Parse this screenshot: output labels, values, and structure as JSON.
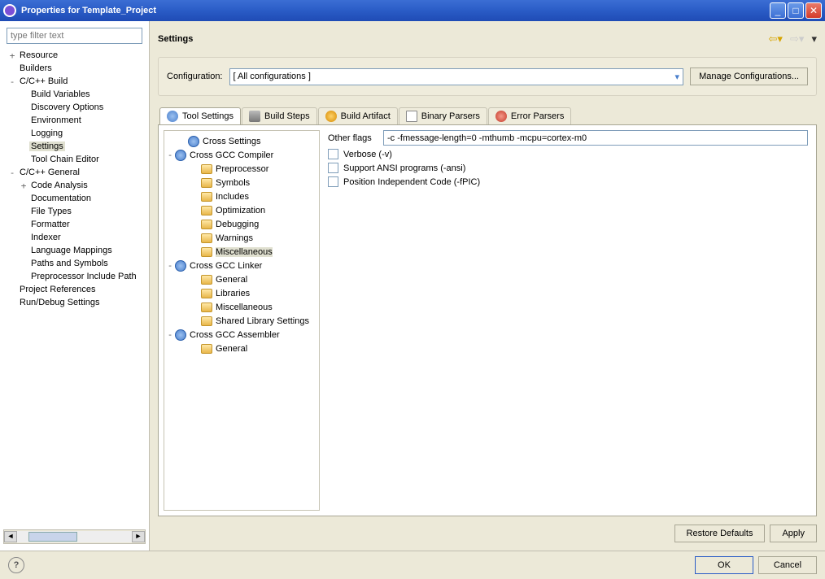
{
  "window": {
    "title": "Properties for Template_Project"
  },
  "filter": {
    "placeholder": "type filter text"
  },
  "left_tree": [
    {
      "exp": "+",
      "label": "Resource",
      "ind": 0
    },
    {
      "exp": "",
      "label": "Builders",
      "ind": 0
    },
    {
      "exp": "-",
      "label": "C/C++ Build",
      "ind": 0
    },
    {
      "exp": "",
      "label": "Build Variables",
      "ind": 1
    },
    {
      "exp": "",
      "label": "Discovery Options",
      "ind": 1
    },
    {
      "exp": "",
      "label": "Environment",
      "ind": 1
    },
    {
      "exp": "",
      "label": "Logging",
      "ind": 1
    },
    {
      "exp": "",
      "label": "Settings",
      "ind": 1,
      "selected": true
    },
    {
      "exp": "",
      "label": "Tool Chain Editor",
      "ind": 1
    },
    {
      "exp": "-",
      "label": "C/C++ General",
      "ind": 0
    },
    {
      "exp": "+",
      "label": "Code Analysis",
      "ind": 1
    },
    {
      "exp": "",
      "label": "Documentation",
      "ind": 1
    },
    {
      "exp": "",
      "label": "File Types",
      "ind": 1
    },
    {
      "exp": "",
      "label": "Formatter",
      "ind": 1
    },
    {
      "exp": "",
      "label": "Indexer",
      "ind": 1
    },
    {
      "exp": "",
      "label": "Language Mappings",
      "ind": 1
    },
    {
      "exp": "",
      "label": "Paths and Symbols",
      "ind": 1
    },
    {
      "exp": "",
      "label": "Preprocessor Include Path",
      "ind": 1
    },
    {
      "exp": "",
      "label": "Project References",
      "ind": 0
    },
    {
      "exp": "",
      "label": "Run/Debug Settings",
      "ind": 0
    }
  ],
  "header": {
    "title": "Settings"
  },
  "config": {
    "label": "Configuration:",
    "value": "[ All configurations ]",
    "manage": "Manage Configurations..."
  },
  "tabs": [
    {
      "label": "Tool Settings",
      "icon": "ti-blue",
      "active": true
    },
    {
      "label": "Build Steps",
      "icon": "ti-wand"
    },
    {
      "label": "Build Artifact",
      "icon": "ti-trophy"
    },
    {
      "label": "Binary Parsers",
      "icon": "ti-doc"
    },
    {
      "label": "Error Parsers",
      "icon": "ti-red"
    }
  ],
  "tool_tree": [
    {
      "exp": "",
      "icon": "blue",
      "label": "Cross Settings",
      "ind": 1
    },
    {
      "exp": "-",
      "icon": "blue",
      "label": "Cross GCC Compiler",
      "ind": 0
    },
    {
      "exp": "",
      "icon": "f",
      "label": "Preprocessor",
      "ind": 2
    },
    {
      "exp": "",
      "icon": "f",
      "label": "Symbols",
      "ind": 2
    },
    {
      "exp": "",
      "icon": "f",
      "label": "Includes",
      "ind": 2
    },
    {
      "exp": "",
      "icon": "f",
      "label": "Optimization",
      "ind": 2
    },
    {
      "exp": "",
      "icon": "f",
      "label": "Debugging",
      "ind": 2
    },
    {
      "exp": "",
      "icon": "f",
      "label": "Warnings",
      "ind": 2
    },
    {
      "exp": "",
      "icon": "f",
      "label": "Miscellaneous",
      "ind": 2,
      "selected": true
    },
    {
      "exp": "-",
      "icon": "blue",
      "label": "Cross GCC Linker",
      "ind": 0
    },
    {
      "exp": "",
      "icon": "f",
      "label": "General",
      "ind": 2
    },
    {
      "exp": "",
      "icon": "f",
      "label": "Libraries",
      "ind": 2
    },
    {
      "exp": "",
      "icon": "f",
      "label": "Miscellaneous",
      "ind": 2
    },
    {
      "exp": "",
      "icon": "f",
      "label": "Shared Library Settings",
      "ind": 2
    },
    {
      "exp": "-",
      "icon": "blue",
      "label": "Cross GCC Assembler",
      "ind": 0
    },
    {
      "exp": "",
      "icon": "f",
      "label": "General",
      "ind": 2
    }
  ],
  "form": {
    "other_flags_label": "Other flags",
    "other_flags_value": "-c -fmessage-length=0 -mthumb -mcpu=cortex-m0",
    "verbose": "Verbose (-v)",
    "ansi": "Support ANSI programs (-ansi)",
    "fpic": "Position Independent Code (-fPIC)"
  },
  "buttons": {
    "restore": "Restore Defaults",
    "apply": "Apply",
    "ok": "OK",
    "cancel": "Cancel"
  }
}
